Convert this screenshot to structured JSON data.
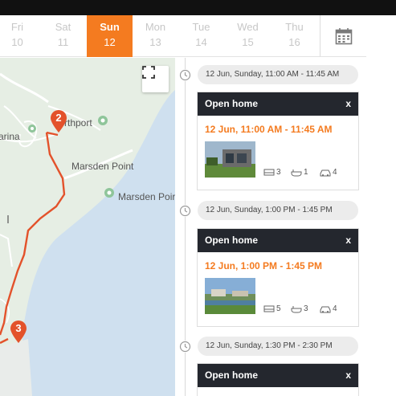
{
  "days": [
    {
      "name": "Fri",
      "date": "10",
      "active": false
    },
    {
      "name": "Sat",
      "date": "11",
      "active": false
    },
    {
      "name": "Sun",
      "date": "12",
      "active": true
    },
    {
      "name": "Mon",
      "date": "13",
      "active": false
    },
    {
      "name": "Tue",
      "date": "14",
      "active": false
    },
    {
      "name": "Wed",
      "date": "15",
      "active": false
    },
    {
      "name": "Thu",
      "date": "16",
      "active": false
    }
  ],
  "calendar_button": {
    "icon": "calendar-icon"
  },
  "map": {
    "labels": {
      "place_1": "arina",
      "place_2": "rthport",
      "place_3": "Marsden Point",
      "place_4": "Marsden Poir"
    },
    "markers": [
      "2",
      "3"
    ],
    "expand_icon": "expand-icon",
    "colors": {
      "land": "#e7efe6",
      "water": "#cfe0ef",
      "route": "#e3522b",
      "marker": "#e3522b"
    }
  },
  "timeline": [
    {
      "time_label": "12 Jun, Sunday, 11:00 AM - 11:45 AM",
      "card_title": "Open home",
      "close": "x",
      "card_time": "12 Jun, 11:00 AM - 11:45 AM",
      "beds": "3",
      "baths": "1",
      "cars": "4"
    },
    {
      "time_label": "12 Jun, Sunday, 1:00 PM - 1:45 PM",
      "card_title": "Open home",
      "close": "x",
      "card_time": "12 Jun, 1:00 PM - 1:45 PM",
      "beds": "5",
      "baths": "3",
      "cars": "4"
    },
    {
      "time_label": "12 Jun, Sunday, 1:30 PM - 2:30 PM",
      "card_title": "Open home",
      "close": "x"
    }
  ],
  "accent_color": "#f47b20"
}
